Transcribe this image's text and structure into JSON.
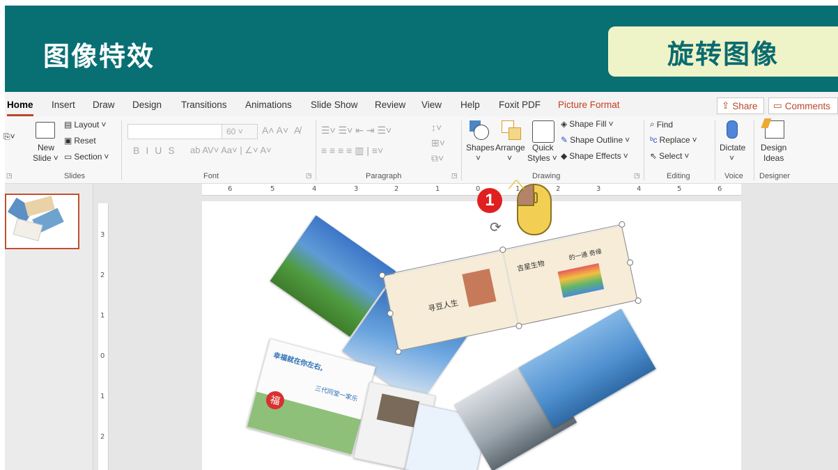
{
  "banner": {
    "title": "图像特效",
    "tag": "旋转图像"
  },
  "tabs": [
    {
      "label": "Home"
    },
    {
      "label": "Insert"
    },
    {
      "label": "Draw"
    },
    {
      "label": "Design"
    },
    {
      "label": "Transitions"
    },
    {
      "label": "Animations"
    },
    {
      "label": "Slide Show"
    },
    {
      "label": "Review"
    },
    {
      "label": "View"
    },
    {
      "label": "Help"
    },
    {
      "label": "Foxit PDF"
    },
    {
      "label": "Picture Format"
    }
  ],
  "share_label": "Share",
  "comments_label": "Comments",
  "ribbon": {
    "slides": {
      "new_slide": "New",
      "new_slide2": "Slide",
      "layout": "Layout",
      "reset": "Reset",
      "section": "Section",
      "group": "Slides"
    },
    "font": {
      "size": "60",
      "group": "Font"
    },
    "paragraph": {
      "group": "Paragraph"
    },
    "drawing": {
      "shapes": "Shapes",
      "arrange": "Arrange",
      "quick1": "Quick",
      "quick2": "Styles",
      "shape_fill": "Shape Fill",
      "shape_outline": "Shape Outline",
      "shape_effects": "Shape Effects",
      "group": "Drawing"
    },
    "editing": {
      "find": "Find",
      "replace": "Replace",
      "select": "Select",
      "group": "Editing"
    },
    "voice": {
      "dictate": "Dictate",
      "group": "Voice"
    },
    "designer": {
      "design1": "Design",
      "design2": "Ideas",
      "group": "Designer"
    }
  },
  "hruler_numbers": [
    "6",
    "5",
    "4",
    "3",
    "2",
    "1",
    "0",
    "1",
    "2",
    "3",
    "4",
    "5",
    "6"
  ],
  "vruler_numbers": [
    "3",
    "2",
    "1",
    "0",
    "1",
    "2"
  ],
  "step_number": "1",
  "slide_texts": {
    "mag1_title": "寻豆人生",
    "mag2_title": "吉星生物",
    "mag2_sub": "的一通 奇缘",
    "card_title": "幸福就在你左右,",
    "card_sub": "三代同堂一家乐",
    "card_fu": "福"
  },
  "colors": {
    "banner": "#086f73",
    "tag_bg": "#eff3c8",
    "accent": "#b7472a",
    "picture_format": "#c43e1c",
    "badge": "#e02020"
  }
}
